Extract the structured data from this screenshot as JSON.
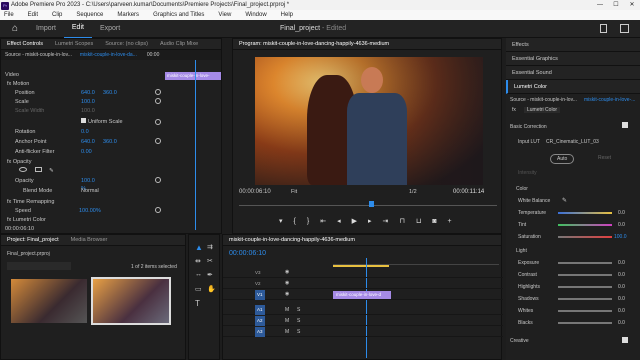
{
  "titlebar": {
    "app_icon": "Pr",
    "title": "Adobe Premiere Pro 2023 - C:\\Users\\parveen.kumar\\Documents\\Premiere Projects\\Final_project.prproj *",
    "minimize": "—",
    "maximize": "☐",
    "close": "✕"
  },
  "menubar": [
    "File",
    "Edit",
    "Clip",
    "Sequence",
    "Markers",
    "Graphics and Titles",
    "View",
    "Window",
    "Help"
  ],
  "header": {
    "home_icon": "⌂",
    "tabs": [
      "Import",
      "Edit",
      "Export"
    ],
    "project_name": "Final_project",
    "project_status": "- Edited"
  },
  "effect_controls": {
    "tabs": [
      "Effect Controls",
      "Lumetri Scopes",
      "Source: (no clips)",
      "Audio Clip Mixe"
    ],
    "source": "Source - miskit-couple-in-lov...",
    "clip": "miskit-couple-in-love-da...",
    "timecode_start": "00:00",
    "clip_bar_label": "miskit-couple-in-love-",
    "video_header": "Video",
    "motion": "Motion",
    "position_label": "Position",
    "position_x": "640.0",
    "position_y": "360.0",
    "scale_label": "Scale",
    "scale_value": "100.0",
    "scale_width_label": "Scale Width",
    "scale_width_value": "100.0",
    "uniform_scale": "Uniform Scale",
    "rotation_label": "Rotation",
    "rotation_value": "0.0",
    "anchor_label": "Anchor Point",
    "anchor_x": "640.0",
    "anchor_y": "360.0",
    "antiflicker_label": "Anti-flicker Filter",
    "antiflicker_value": "0.00",
    "opacity_header": "Opacity",
    "opacity_label": "Opacity",
    "opacity_value": "100.0 %",
    "blend_label": "Blend Mode",
    "blend_value": "Normal",
    "time_remap": "Time Remapping",
    "speed_label": "Speed",
    "speed_value": "100.00%",
    "lumetri_label": "Lumetri Color",
    "timecode": "00:00:06:10"
  },
  "program": {
    "title": "Program: miskit-couple-in-love-dancing-happily-4636-medium",
    "timecode": "00:00:06:10",
    "fit": "Fit",
    "ratio": "1/2",
    "duration": "00:00:11:14"
  },
  "right_panel": {
    "items": [
      "Effects",
      "Essential Graphics",
      "Essential Sound",
      "Lumetri Color"
    ],
    "source_label": "Source - miskit-couple-in-lov...",
    "clip_label": "miskit-couple-in-love-...",
    "fx": "fx",
    "lumetri_name": "Lumetri Color",
    "basic_correction": "Basic Correction",
    "input_lut_label": "Input LUT",
    "input_lut_value": "CR_Cinematic_LUT_03",
    "auto": "Auto",
    "reset": "Reset",
    "intensity": "Intensity",
    "color_header": "Color",
    "white_balance": "White Balance",
    "temperature": "Temperature",
    "temperature_value": "0.0",
    "tint": "Tint",
    "tint_value": "0.0",
    "saturation": "Saturation",
    "saturation_value": "100.0",
    "light_header": "Light",
    "exposure": "Exposure",
    "exposure_value": "0.0",
    "contrast": "Contrast",
    "contrast_value": "0.0",
    "highlights": "Highlights",
    "highlights_value": "0.0",
    "shadows": "Shadows",
    "shadows_value": "0.0",
    "whites": "Whites",
    "whites_value": "0.0",
    "blacks": "Blacks",
    "blacks_value": "0.0",
    "creative": "Creative"
  },
  "project_panel": {
    "tabs": [
      "Project: Final_project",
      "Media Browser"
    ],
    "file": "Final_project.prproj",
    "count": "1 of 2 items selected"
  },
  "timeline": {
    "sequence": "miskit-couple-in-love-dancing-happily-4636-medium",
    "timecode": "00:00:06:10",
    "tracks": [
      "V3",
      "V2",
      "V1",
      "A1",
      "A2",
      "A3"
    ],
    "clip_label": "miskit-couple-in-love-d",
    "m": "M",
    "s": "S"
  },
  "colors": {
    "accent": "#2d8ceb",
    "clip_purple": "#a58ae6",
    "timeline_blue": "#2d8ceb"
  }
}
